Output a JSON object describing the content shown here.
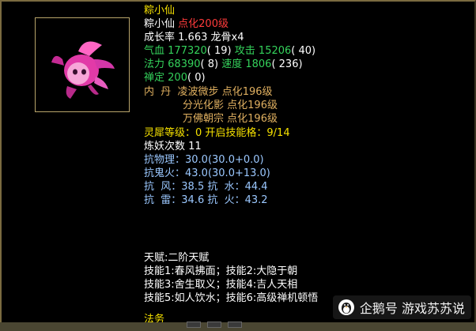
{
  "pet": {
    "header_name": "粽小仙",
    "name": "粽小仙",
    "enhance": "点化200级",
    "growth_label": "成长率",
    "growth_value": "1.663",
    "growth_extra": "龙骨x4",
    "hp_label": "气血",
    "hp_value": "177320",
    "hp_points": "( 19)",
    "atk_label": "攻击",
    "atk_value": "15206",
    "atk_points": "( 40)",
    "mp_label": "法力",
    "mp_value": "68390",
    "mp_points": "( 8)",
    "spd_label": "速度",
    "spd_value": "1806",
    "spd_points": "( 236)",
    "zen_label": "禅定",
    "zen_value": "200",
    "zen_points": "( 0)"
  },
  "inner_pills": {
    "label": "内  丹",
    "items": [
      {
        "name": "凌波微步",
        "level": "点化196级"
      },
      {
        "name": "分光化影",
        "level": "点化196级"
      },
      {
        "name": "万佛朝宗",
        "level": "点化196级"
      }
    ]
  },
  "lingxi": "灵犀等级：0 开启技能格：9/14",
  "refine": "炼妖次数 11",
  "resist": {
    "phys": "抗物理：30.0(30.0+0.0)",
    "ghost": "抗鬼火：43.0(30.0+13.0)",
    "wind_label": "抗  风：",
    "wind_value": "38.5",
    "water_label": "抗  水：",
    "water_value": "44.4",
    "thunder_label": "抗  雷：",
    "thunder_value": "34.6",
    "fire_label": "抗  火：",
    "fire_value": "43.2"
  },
  "talent": "天赋:二阶天赋",
  "skills": [
    "技能1:春风拂面；技能2:大隐于朝",
    "技能3:舍生取义；技能4:吉人天相",
    "技能5:如人饮水；技能6:高级禅机顿悟"
  ],
  "cut_text": "法务",
  "watermark": "企鹅号 游戏苏苏说",
  "colors": {
    "name": "#f5e000",
    "enhance": "#ff3b3b",
    "stat_value": "#34d25b",
    "pill": "#e0b060",
    "resist": "#9bc8ff",
    "skill": "#ffffff"
  }
}
